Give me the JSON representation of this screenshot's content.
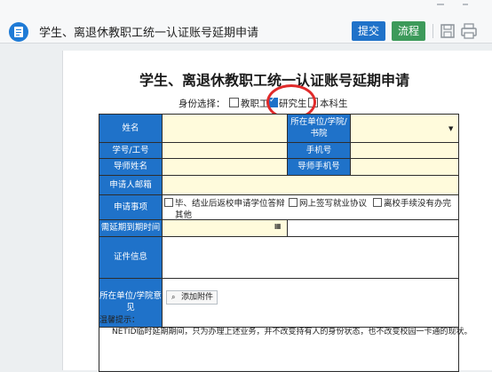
{
  "header": {
    "title": "学生、离退休教职工统一认证账号延期申请",
    "submit_label": "提交",
    "flow_label": "流程",
    "icons": [
      "document-icon",
      "save-icon",
      "print-icon"
    ],
    "colors": {
      "submit": "#1f72c9",
      "flow": "#3d9a5a",
      "label_bg": "#1f72c9",
      "field_bg": "#fffbdc"
    }
  },
  "form": {
    "title": "学生、离退休教职工统一认证账号延期申请",
    "identity_label": "身份选择：",
    "identity_options": [
      {
        "label": "教职工",
        "checked": false
      },
      {
        "label": "研究生",
        "checked": true
      },
      {
        "label": "本科生",
        "checked": false
      }
    ],
    "labels": {
      "name": "姓名",
      "unit": "所在单位/学院/书院",
      "student_id": "学号/工号",
      "phone": "手机号",
      "advisor": "导师姓名",
      "advisor_phone": "导师手机号",
      "email": "申请人邮箱",
      "matters": "申请事项",
      "deadline": "需延期到期时间",
      "certificate": "证件信息",
      "opinion": "所在单位/学院意见"
    },
    "matter_options": [
      "毕、结业后返校申请学位答辩",
      "网上签写就业协议",
      "离校手续没有办完",
      "其他"
    ],
    "attach_label": "添加附件",
    "tip_title": "温馨提示：",
    "tip_text": "NETID临时延期期间，只为办理上述业务，并不改变持有人的身份状态，也不改变校园一卡通的现状。"
  }
}
